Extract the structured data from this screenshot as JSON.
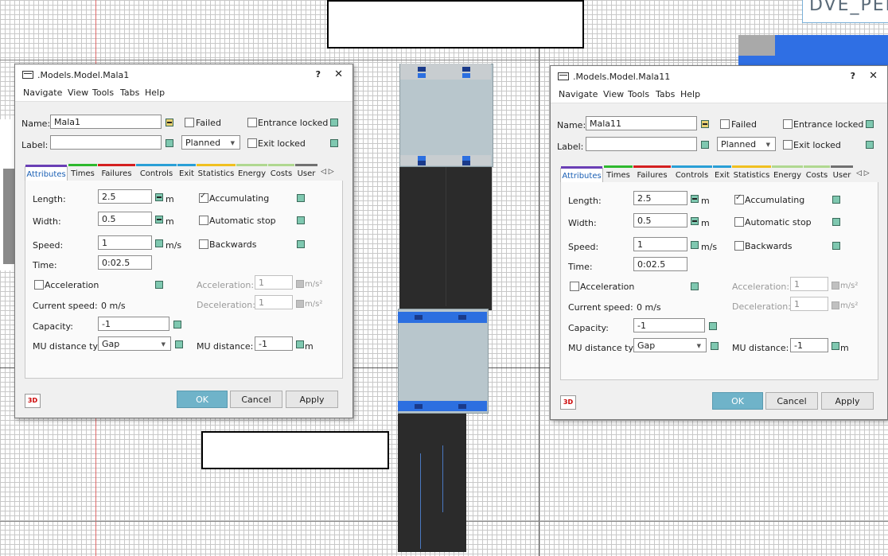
{
  "canvas": {
    "corner_text": "DVE_PEN"
  },
  "dialogs": [
    {
      "title": ".Models.Model.Mala1",
      "help_button": "?",
      "close_button": "✕",
      "menu": [
        "Navigate",
        "View",
        "Tools",
        "Tabs",
        "Help"
      ],
      "name_label": "Name:",
      "name_value": "Mala1",
      "label_label": "Label:",
      "label_value": "",
      "failed_label": "Failed",
      "entrance_locked_label": "Entrance locked",
      "planned_value": "Planned",
      "exit_locked_label": "Exit locked",
      "tabs": [
        {
          "label": "Attributes",
          "color": "#6a3fb5"
        },
        {
          "label": "Times",
          "color": "#2eb82e"
        },
        {
          "label": "Failures",
          "color": "#d42020"
        },
        {
          "label": "Controls",
          "color": "#2a9fd6"
        },
        {
          "label": "Exit",
          "color": "#2a9fd6"
        },
        {
          "label": "Statistics",
          "color": "#f0c020"
        },
        {
          "label": "Energy",
          "color": "#b0d890"
        },
        {
          "label": "Costs",
          "color": "#b0d890"
        },
        {
          "label": "User",
          "color": "#707070"
        }
      ],
      "tab_scroll": "◁ ▷",
      "length_label": "Length:",
      "length_value": "2.5",
      "length_unit": "m",
      "width_label": "Width:",
      "width_value": "0.5",
      "width_unit": "m",
      "speed_label": "Speed:",
      "speed_value": "1",
      "speed_unit": "m/s",
      "time_label": "Time:",
      "time_value": "0:02.5",
      "accumulating_label": "Accumulating",
      "automatic_stop_label": "Automatic stop",
      "backwards_label": "Backwards",
      "acceleration_check_label": "Acceleration",
      "current_speed_label": "Current speed:",
      "current_speed_value": "0 m/s",
      "acceleration_label": "Acceleration:",
      "acceleration_value": "1",
      "acceleration_unit": "m/s²",
      "deceleration_label": "Deceleration:",
      "deceleration_value": "1",
      "deceleration_unit": "m/s²",
      "capacity_label": "Capacity:",
      "capacity_value": "-1",
      "mu_distance_type_label": "MU distance type:",
      "mu_distance_type_value": "Gap",
      "mu_distance_label": "MU distance:",
      "mu_distance_value": "-1",
      "mu_distance_unit": "m",
      "btn_3d": "3D",
      "ok_label": "OK",
      "cancel_label": "Cancel",
      "apply_label": "Apply"
    },
    {
      "title": ".Models.Model.Mala11",
      "help_button": "?",
      "close_button": "✕",
      "menu": [
        "Navigate",
        "View",
        "Tools",
        "Tabs",
        "Help"
      ],
      "name_label": "Name:",
      "name_value": "Mala11",
      "label_label": "Label:",
      "label_value": "",
      "failed_label": "Failed",
      "entrance_locked_label": "Entrance locked",
      "planned_value": "Planned",
      "exit_locked_label": "Exit locked",
      "tabs": [
        {
          "label": "Attributes",
          "color": "#6a3fb5"
        },
        {
          "label": "Times",
          "color": "#2eb82e"
        },
        {
          "label": "Failures",
          "color": "#d42020"
        },
        {
          "label": "Controls",
          "color": "#2a9fd6"
        },
        {
          "label": "Exit",
          "color": "#2a9fd6"
        },
        {
          "label": "Statistics",
          "color": "#f0c020"
        },
        {
          "label": "Energy",
          "color": "#b0d890"
        },
        {
          "label": "Costs",
          "color": "#b0d890"
        },
        {
          "label": "User",
          "color": "#707070"
        }
      ],
      "tab_scroll": "◁ ▷",
      "length_label": "Length:",
      "length_value": "2.5",
      "length_unit": "m",
      "width_label": "Width:",
      "width_value": "0.5",
      "width_unit": "m",
      "speed_label": "Speed:",
      "speed_value": "1",
      "speed_unit": "m/s",
      "time_label": "Time:",
      "time_value": "0:02.5",
      "accumulating_label": "Accumulating",
      "automatic_stop_label": "Automatic stop",
      "backwards_label": "Backwards",
      "acceleration_check_label": "Acceleration",
      "current_speed_label": "Current speed:",
      "current_speed_value": "0 m/s",
      "acceleration_label": "Acceleration:",
      "acceleration_value": "1",
      "acceleration_unit": "m/s²",
      "deceleration_label": "Deceleration:",
      "deceleration_value": "1",
      "deceleration_unit": "m/s²",
      "capacity_label": "Capacity:",
      "capacity_value": "-1",
      "mu_distance_type_label": "MU distance type:",
      "mu_distance_type_value": "Gap",
      "mu_distance_label": "MU distance:",
      "mu_distance_value": "-1",
      "mu_distance_unit": "m",
      "btn_3d": "3D",
      "ok_label": "OK",
      "cancel_label": "Cancel",
      "apply_label": "Apply"
    }
  ]
}
